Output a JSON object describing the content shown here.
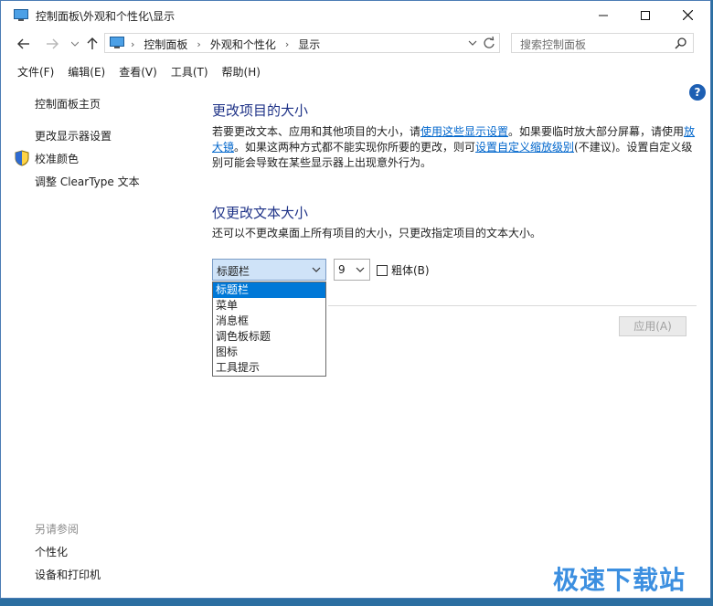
{
  "window": {
    "title": "控制面板\\外观和个性化\\显示"
  },
  "address": {
    "crumbs": [
      "控制面板",
      "外观和个性化",
      "显示"
    ],
    "search_placeholder": "搜索控制面板"
  },
  "menu": [
    "文件(F)",
    "编辑(E)",
    "查看(V)",
    "工具(T)",
    "帮助(H)"
  ],
  "sidebar": {
    "home": "控制面板主页",
    "items": [
      "更改显示器设置",
      "校准颜色",
      "调整 ClearType 文本"
    ],
    "see_also_label": "另请参阅",
    "see_also": [
      "个性化",
      "设备和打印机"
    ]
  },
  "section1": {
    "heading": "更改项目的大小",
    "p1_a": "若要更改文本、应用和其他项目的大小，请",
    "link1": "使用这些显示设置",
    "p1_b": "。如果要临时放大部分屏幕，请使用",
    "link2": "放大镜",
    "p1_c": "。如果这两种方式都不能实现你所要的更改，则可",
    "link3": "设置自定义缩放级别",
    "p1_d": "(不建议)。设置自定义级别可能会导致在某些显示器上出现意外行为。"
  },
  "section2": {
    "heading": "仅更改文本大小",
    "desc": "还可以不更改桌面上所有项目的大小，只更改指定项目的文本大小。",
    "item_select": "标题栏",
    "size_select": "9",
    "bold_label": "粗体(B)",
    "options": [
      "标题栏",
      "菜单",
      "消息框",
      "调色板标题",
      "图标",
      "工具提示"
    ],
    "apply_label": "应用(A)"
  },
  "help_icon_text": "?",
  "watermark": "极速下载站",
  "colors": {
    "link": "#0066cc",
    "heading": "#1e3287",
    "selection": "#0078d7"
  }
}
